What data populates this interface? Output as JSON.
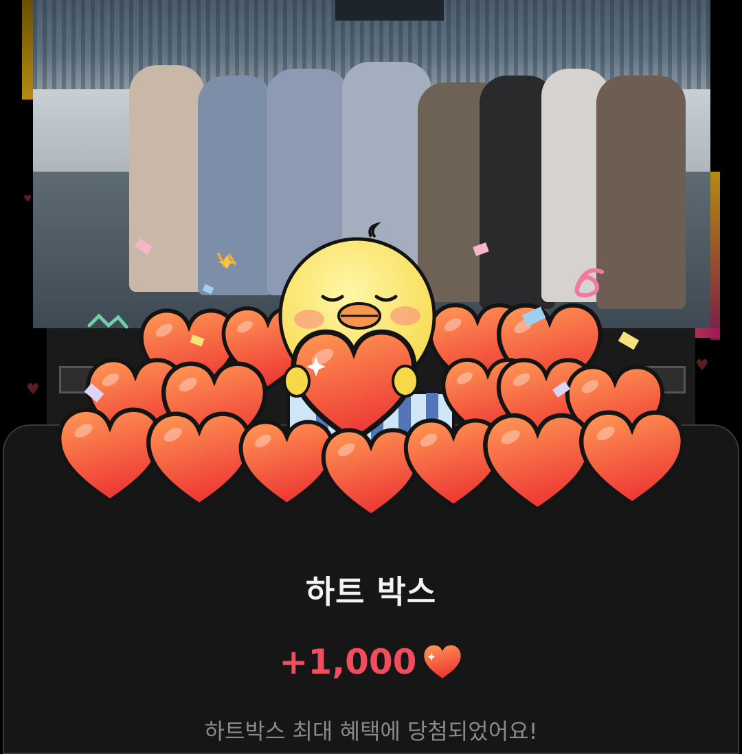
{
  "reward": {
    "title": "하트 박스",
    "amount": "+1,000",
    "message": "하트박스 최대 혜택에 당첨되었어요!"
  },
  "colors": {
    "accent": "#f24d5e",
    "heart_top": "#ff8a4a",
    "heart_bottom": "#ef3e36",
    "background": "#000000",
    "sheet": "#161616"
  },
  "icons": {
    "amount_icon": "heart-icon",
    "character": "yellow-chick-character"
  }
}
